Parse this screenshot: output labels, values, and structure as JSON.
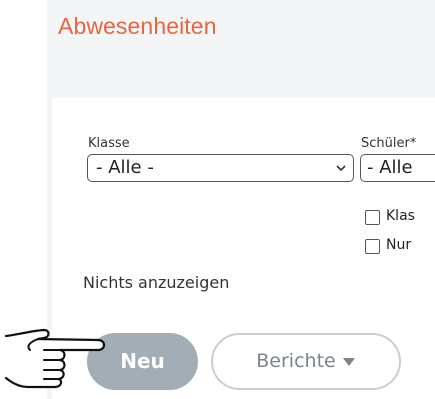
{
  "page": {
    "title": "Abwesenheiten"
  },
  "filters": {
    "klasse_label": "Klasse",
    "klasse_value": "- Alle -",
    "schueler_label": "Schüler*",
    "schueler_value": "- Alle"
  },
  "checkboxes": [
    {
      "label": "Klas",
      "checked": false
    },
    {
      "label": "Nur",
      "checked": false
    }
  ],
  "empty_message": "Nichts anzuzeigen",
  "buttons": {
    "new_label": "Neu",
    "reports_label": "Berichte"
  },
  "colors": {
    "title": "#e8663d",
    "primary_button": "#a3adb5",
    "secondary_border": "#c9ced3"
  },
  "icons": {
    "dropdown": "chevron-down-icon",
    "reports_caret": "caret-down-icon",
    "cursor": "pointing-hand-icon"
  }
}
